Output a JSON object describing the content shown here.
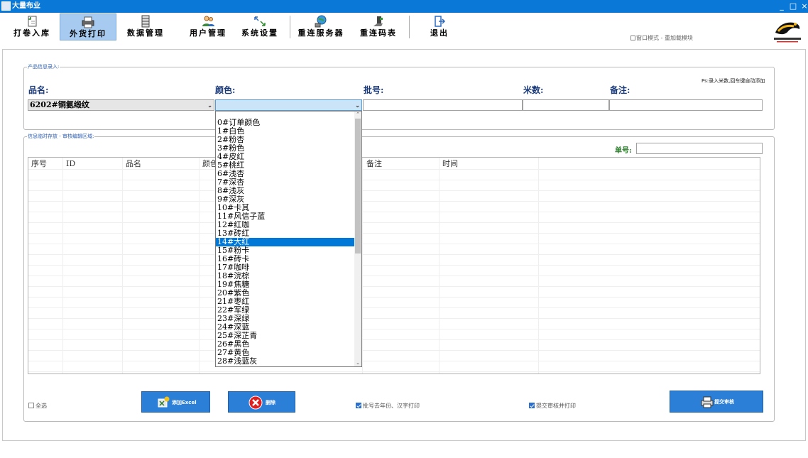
{
  "window": {
    "title": "大量布业",
    "controls": [
      "_",
      "□",
      "×"
    ]
  },
  "toolbar": {
    "buttons": [
      {
        "label": "打卷入库",
        "icon": "add-document-icon"
      },
      {
        "label": "外货打印",
        "icon": "printer-icon",
        "active": true
      },
      {
        "label": "数据管理",
        "icon": "database-icon"
      },
      {
        "label": "用户管理",
        "icon": "users-icon"
      },
      {
        "label": "系统设置",
        "icon": "settings-icon"
      },
      {
        "label": "重连服务器",
        "icon": "globe-network-icon"
      },
      {
        "label": "重连码表",
        "icon": "scale-device-icon"
      },
      {
        "label": "退出",
        "icon": "exit-icon"
      }
    ],
    "window_mode_label": "窗口模式 - 重加载模块"
  },
  "product_group": {
    "legend": "产品信息录入:",
    "labels": {
      "name": "品名:",
      "color": "颜色:",
      "batch": "批号:",
      "meters": "米数:",
      "remark": "备注:"
    },
    "ps_note": "Ps:录入米数,回车键自动添加",
    "name_value": "6202#铜氨缎纹",
    "color_value": "",
    "batch_value": "",
    "meters_value": "",
    "remark_value": ""
  },
  "temp_group": {
    "legend": "信息临时存放 - 审核编辑区域:",
    "order_label": "单号:",
    "order_value": "",
    "columns": [
      "序号",
      "ID",
      "品名",
      "颜色",
      "备注",
      "时间"
    ]
  },
  "color_dropdown": {
    "items": [
      "0#订单颜色",
      "1#白色",
      "2#粉杏",
      "3#粉色",
      "4#皮红",
      "5#桃红",
      "6#浅杏",
      "7#深杏",
      "8#浅灰",
      "9#深灰",
      "10#卡其",
      "11#风信子蓝",
      "12#红咖",
      "13#砖红",
      "14#大红",
      "15#粉卡",
      "16#砖卡",
      "17#咖啡",
      "18#浣棕",
      "19#焦糖",
      "20#紫色",
      "21#枣红",
      "22#军绿",
      "23#深绿",
      "24#深蓝",
      "25#深芷青",
      "26#黑色",
      "27#黄色",
      "28#浅蓝灰"
    ],
    "selected_index": 14
  },
  "bottom": {
    "select_all_label": "全选",
    "add_excel_label": "添加Excel",
    "delete_label": "删除",
    "batch_no_year_label": "批号去年份、汉字打印",
    "submit_print_label": "提交审核并打印",
    "submit_label": "提交审核"
  },
  "colors": {
    "titlebar": "#0a78d7",
    "selected": "#0078d7",
    "button": "#2c7fd6",
    "active_tab": "#a6caf0"
  }
}
